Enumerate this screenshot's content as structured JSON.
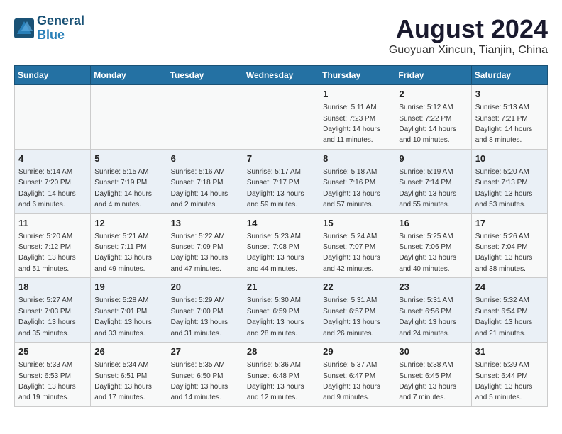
{
  "header": {
    "logo_line1": "General",
    "logo_line2": "Blue",
    "title": "August 2024",
    "subtitle": "Guoyuan Xincun, Tianjin, China"
  },
  "calendar": {
    "days_of_week": [
      "Sunday",
      "Monday",
      "Tuesday",
      "Wednesday",
      "Thursday",
      "Friday",
      "Saturday"
    ],
    "weeks": [
      [
        {
          "day": "",
          "info": ""
        },
        {
          "day": "",
          "info": ""
        },
        {
          "day": "",
          "info": ""
        },
        {
          "day": "",
          "info": ""
        },
        {
          "day": "1",
          "info": "Sunrise: 5:11 AM\nSunset: 7:23 PM\nDaylight: 14 hours\nand 11 minutes."
        },
        {
          "day": "2",
          "info": "Sunrise: 5:12 AM\nSunset: 7:22 PM\nDaylight: 14 hours\nand 10 minutes."
        },
        {
          "day": "3",
          "info": "Sunrise: 5:13 AM\nSunset: 7:21 PM\nDaylight: 14 hours\nand 8 minutes."
        }
      ],
      [
        {
          "day": "4",
          "info": "Sunrise: 5:14 AM\nSunset: 7:20 PM\nDaylight: 14 hours\nand 6 minutes."
        },
        {
          "day": "5",
          "info": "Sunrise: 5:15 AM\nSunset: 7:19 PM\nDaylight: 14 hours\nand 4 minutes."
        },
        {
          "day": "6",
          "info": "Sunrise: 5:16 AM\nSunset: 7:18 PM\nDaylight: 14 hours\nand 2 minutes."
        },
        {
          "day": "7",
          "info": "Sunrise: 5:17 AM\nSunset: 7:17 PM\nDaylight: 13 hours\nand 59 minutes."
        },
        {
          "day": "8",
          "info": "Sunrise: 5:18 AM\nSunset: 7:16 PM\nDaylight: 13 hours\nand 57 minutes."
        },
        {
          "day": "9",
          "info": "Sunrise: 5:19 AM\nSunset: 7:14 PM\nDaylight: 13 hours\nand 55 minutes."
        },
        {
          "day": "10",
          "info": "Sunrise: 5:20 AM\nSunset: 7:13 PM\nDaylight: 13 hours\nand 53 minutes."
        }
      ],
      [
        {
          "day": "11",
          "info": "Sunrise: 5:20 AM\nSunset: 7:12 PM\nDaylight: 13 hours\nand 51 minutes."
        },
        {
          "day": "12",
          "info": "Sunrise: 5:21 AM\nSunset: 7:11 PM\nDaylight: 13 hours\nand 49 minutes."
        },
        {
          "day": "13",
          "info": "Sunrise: 5:22 AM\nSunset: 7:09 PM\nDaylight: 13 hours\nand 47 minutes."
        },
        {
          "day": "14",
          "info": "Sunrise: 5:23 AM\nSunset: 7:08 PM\nDaylight: 13 hours\nand 44 minutes."
        },
        {
          "day": "15",
          "info": "Sunrise: 5:24 AM\nSunset: 7:07 PM\nDaylight: 13 hours\nand 42 minutes."
        },
        {
          "day": "16",
          "info": "Sunrise: 5:25 AM\nSunset: 7:06 PM\nDaylight: 13 hours\nand 40 minutes."
        },
        {
          "day": "17",
          "info": "Sunrise: 5:26 AM\nSunset: 7:04 PM\nDaylight: 13 hours\nand 38 minutes."
        }
      ],
      [
        {
          "day": "18",
          "info": "Sunrise: 5:27 AM\nSunset: 7:03 PM\nDaylight: 13 hours\nand 35 minutes."
        },
        {
          "day": "19",
          "info": "Sunrise: 5:28 AM\nSunset: 7:01 PM\nDaylight: 13 hours\nand 33 minutes."
        },
        {
          "day": "20",
          "info": "Sunrise: 5:29 AM\nSunset: 7:00 PM\nDaylight: 13 hours\nand 31 minutes."
        },
        {
          "day": "21",
          "info": "Sunrise: 5:30 AM\nSunset: 6:59 PM\nDaylight: 13 hours\nand 28 minutes."
        },
        {
          "day": "22",
          "info": "Sunrise: 5:31 AM\nSunset: 6:57 PM\nDaylight: 13 hours\nand 26 minutes."
        },
        {
          "day": "23",
          "info": "Sunrise: 5:31 AM\nSunset: 6:56 PM\nDaylight: 13 hours\nand 24 minutes."
        },
        {
          "day": "24",
          "info": "Sunrise: 5:32 AM\nSunset: 6:54 PM\nDaylight: 13 hours\nand 21 minutes."
        }
      ],
      [
        {
          "day": "25",
          "info": "Sunrise: 5:33 AM\nSunset: 6:53 PM\nDaylight: 13 hours\nand 19 minutes."
        },
        {
          "day": "26",
          "info": "Sunrise: 5:34 AM\nSunset: 6:51 PM\nDaylight: 13 hours\nand 17 minutes."
        },
        {
          "day": "27",
          "info": "Sunrise: 5:35 AM\nSunset: 6:50 PM\nDaylight: 13 hours\nand 14 minutes."
        },
        {
          "day": "28",
          "info": "Sunrise: 5:36 AM\nSunset: 6:48 PM\nDaylight: 13 hours\nand 12 minutes."
        },
        {
          "day": "29",
          "info": "Sunrise: 5:37 AM\nSunset: 6:47 PM\nDaylight: 13 hours\nand 9 minutes."
        },
        {
          "day": "30",
          "info": "Sunrise: 5:38 AM\nSunset: 6:45 PM\nDaylight: 13 hours\nand 7 minutes."
        },
        {
          "day": "31",
          "info": "Sunrise: 5:39 AM\nSunset: 6:44 PM\nDaylight: 13 hours\nand 5 minutes."
        }
      ]
    ]
  }
}
